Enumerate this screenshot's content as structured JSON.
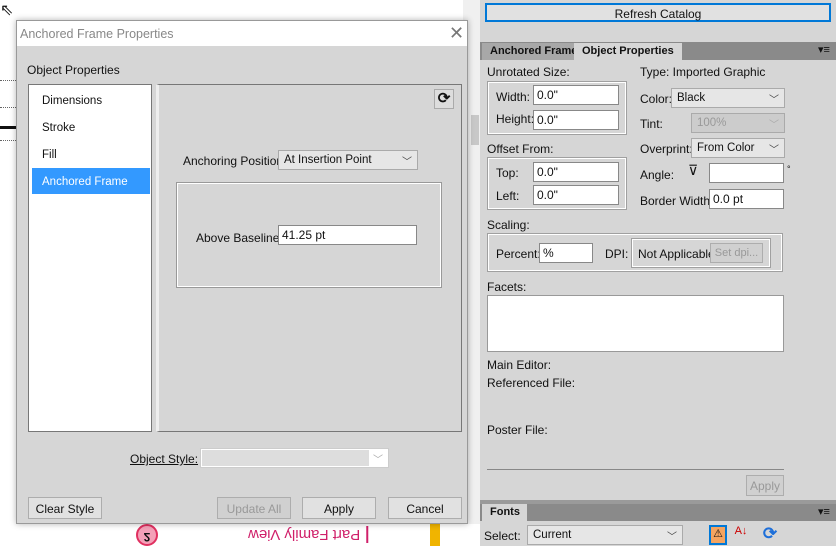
{
  "dialog": {
    "title": "Anchored Frame Properties",
    "section_label": "Object Properties",
    "nav_items": [
      {
        "label": "Dimensions"
      },
      {
        "label": "Stroke"
      },
      {
        "label": "Fill"
      },
      {
        "label": "Anchored Frame",
        "selected": true
      }
    ],
    "anchoring_position_label": "Anchoring Position:",
    "anchoring_position_value": "At Insertion Point",
    "above_baseline_label": "Above Baseline:",
    "above_baseline_value": "41.25 pt",
    "object_style_label": "Object Style:",
    "object_style_value": "",
    "buttons": {
      "clear_style": "Clear Style",
      "update_all": "Update All",
      "apply": "Apply",
      "cancel": "Cancel"
    }
  },
  "background_doc": {
    "badge_number": "2",
    "mirrored_text": "Part Family View"
  },
  "right_panel": {
    "refresh_catalog": "Refresh Catalog",
    "tabs": [
      {
        "label": "Anchored Frame"
      },
      {
        "label": "Object Properties",
        "active": true
      }
    ],
    "unrotated_size_label": "Unrotated Size:",
    "width_label": "Width:",
    "width_value": "0.0\"",
    "height_label": "Height:",
    "height_value": "0.0\"",
    "offset_from_label": "Offset From:",
    "top_label": "Top:",
    "top_value": "0.0\"",
    "left_label": "Left:",
    "left_value": "0.0\"",
    "type_label": "Type: Imported Graphic",
    "color_label": "Color:",
    "color_value": "Black",
    "tint_label": "Tint:",
    "tint_value": "100%",
    "overprint_label": "Overprint:",
    "overprint_value": "From Color",
    "angle_label": "Angle:",
    "angle_value": "",
    "angle_unit": "°",
    "border_width_label": "Border Width:",
    "border_width_value": "0.0 pt",
    "scaling_label": "Scaling:",
    "percent_label": "Percent:",
    "percent_value": "%",
    "dpi_label": "DPI:",
    "dpi_value": "Not Applicable",
    "set_dpi": "Set dpi...",
    "facets_label": "Facets:",
    "main_editor_label": "Main Editor:",
    "referenced_file_label": "Referenced File:",
    "poster_file_label": "Poster File:",
    "apply": "Apply"
  },
  "fonts_panel": {
    "tab": "Fonts",
    "select_label": "Select:",
    "select_value": "Current"
  },
  "colors": {
    "selection": "#3399ff",
    "panel": "#d6d6d6"
  }
}
